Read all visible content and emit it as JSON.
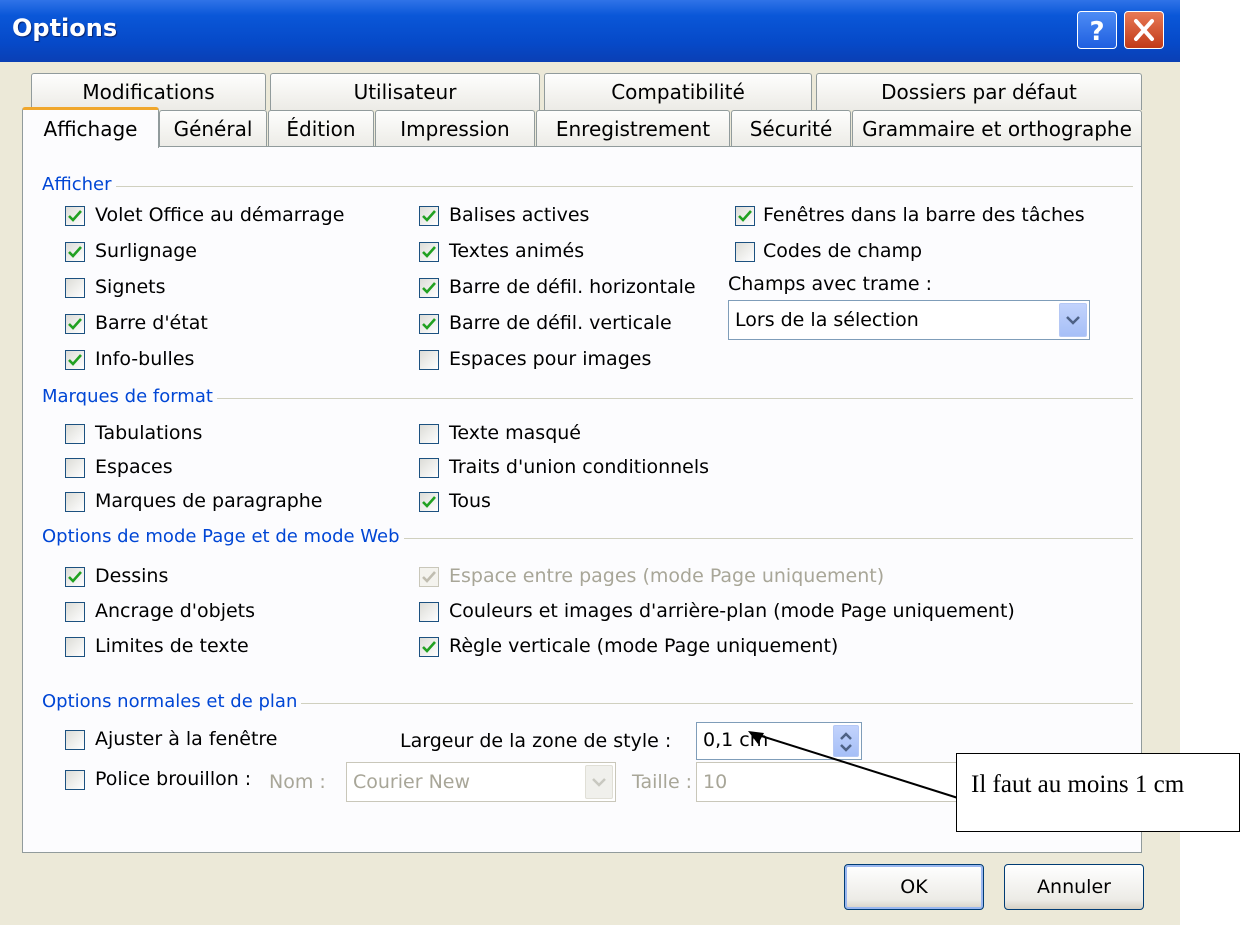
{
  "window": {
    "title": "Options"
  },
  "tabs_row1": [
    "Modifications",
    "Utilisateur",
    "Compatibilité",
    "Dossiers par défaut"
  ],
  "tabs_row2": [
    "Affichage",
    "Général",
    "Édition",
    "Impression",
    "Enregistrement",
    "Sécurité",
    "Grammaire et orthographe"
  ],
  "active_tab": "Affichage",
  "sections": {
    "afficher": "Afficher",
    "marques": "Marques de format",
    "options_page": "Options de mode Page et de mode Web",
    "options_normales": "Options normales et de plan"
  },
  "checkboxes": {
    "volet_office": {
      "label": "Volet Office au démarrage",
      "checked": true
    },
    "surlignage": {
      "label": "Surlignage",
      "checked": true
    },
    "signets": {
      "label": "Signets",
      "checked": false
    },
    "barre_etat": {
      "label": "Barre d'état",
      "checked": true
    },
    "info_bulles": {
      "label": "Info-bulles",
      "checked": true
    },
    "balises_actives": {
      "label": "Balises actives",
      "checked": true
    },
    "textes_animes": {
      "label": "Textes animés",
      "checked": true
    },
    "defil_horizontale": {
      "label": "Barre de défil. horizontale",
      "checked": true
    },
    "defil_verticale": {
      "label": "Barre de défil. verticale",
      "checked": true
    },
    "espaces_images": {
      "label": "Espaces pour images",
      "checked": false
    },
    "fenetres_barre": {
      "label": "Fenêtres dans la barre des tâches",
      "checked": true
    },
    "codes_champ": {
      "label": "Codes de champ",
      "checked": false
    },
    "tabulations": {
      "label": "Tabulations",
      "checked": false
    },
    "espaces": {
      "label": "Espaces",
      "checked": false
    },
    "marques_paragraphe": {
      "label": "Marques de paragraphe",
      "checked": false
    },
    "texte_masque": {
      "label": "Texte masqué",
      "checked": false
    },
    "traits_union": {
      "label": "Traits d'union conditionnels",
      "checked": false
    },
    "tous": {
      "label": "Tous",
      "checked": true
    },
    "dessins": {
      "label": "Dessins",
      "checked": true
    },
    "ancrage": {
      "label": "Ancrage d'objets",
      "checked": false
    },
    "limites_texte": {
      "label": "Limites de texte",
      "checked": false
    },
    "espace_pages": {
      "label": "Espace entre pages (mode Page uniquement)",
      "checked": true,
      "disabled": true
    },
    "couleurs_images": {
      "label": "Couleurs et images d'arrière-plan (mode Page uniquement)",
      "checked": false
    },
    "regle_verticale": {
      "label": "Règle verticale (mode Page uniquement)",
      "checked": true
    },
    "ajuster_fenetre": {
      "label": "Ajuster à la fenêtre",
      "checked": false
    },
    "police_brouillon": {
      "label": "Police brouillon :",
      "checked": false
    }
  },
  "champs_trame": {
    "label": "Champs avec trame :",
    "value": "Lors de la sélection"
  },
  "zone_style": {
    "label": "Largeur de la zone de style :",
    "value": "0,1 cm"
  },
  "brouillon": {
    "nom_label": "Nom :",
    "nom_value": "Courier New",
    "taille_label": "Taille :",
    "taille_value": "10"
  },
  "buttons": {
    "ok": "OK",
    "annuler": "Annuler"
  },
  "annotation": {
    "text": "Il faut au moins 1 cm"
  }
}
